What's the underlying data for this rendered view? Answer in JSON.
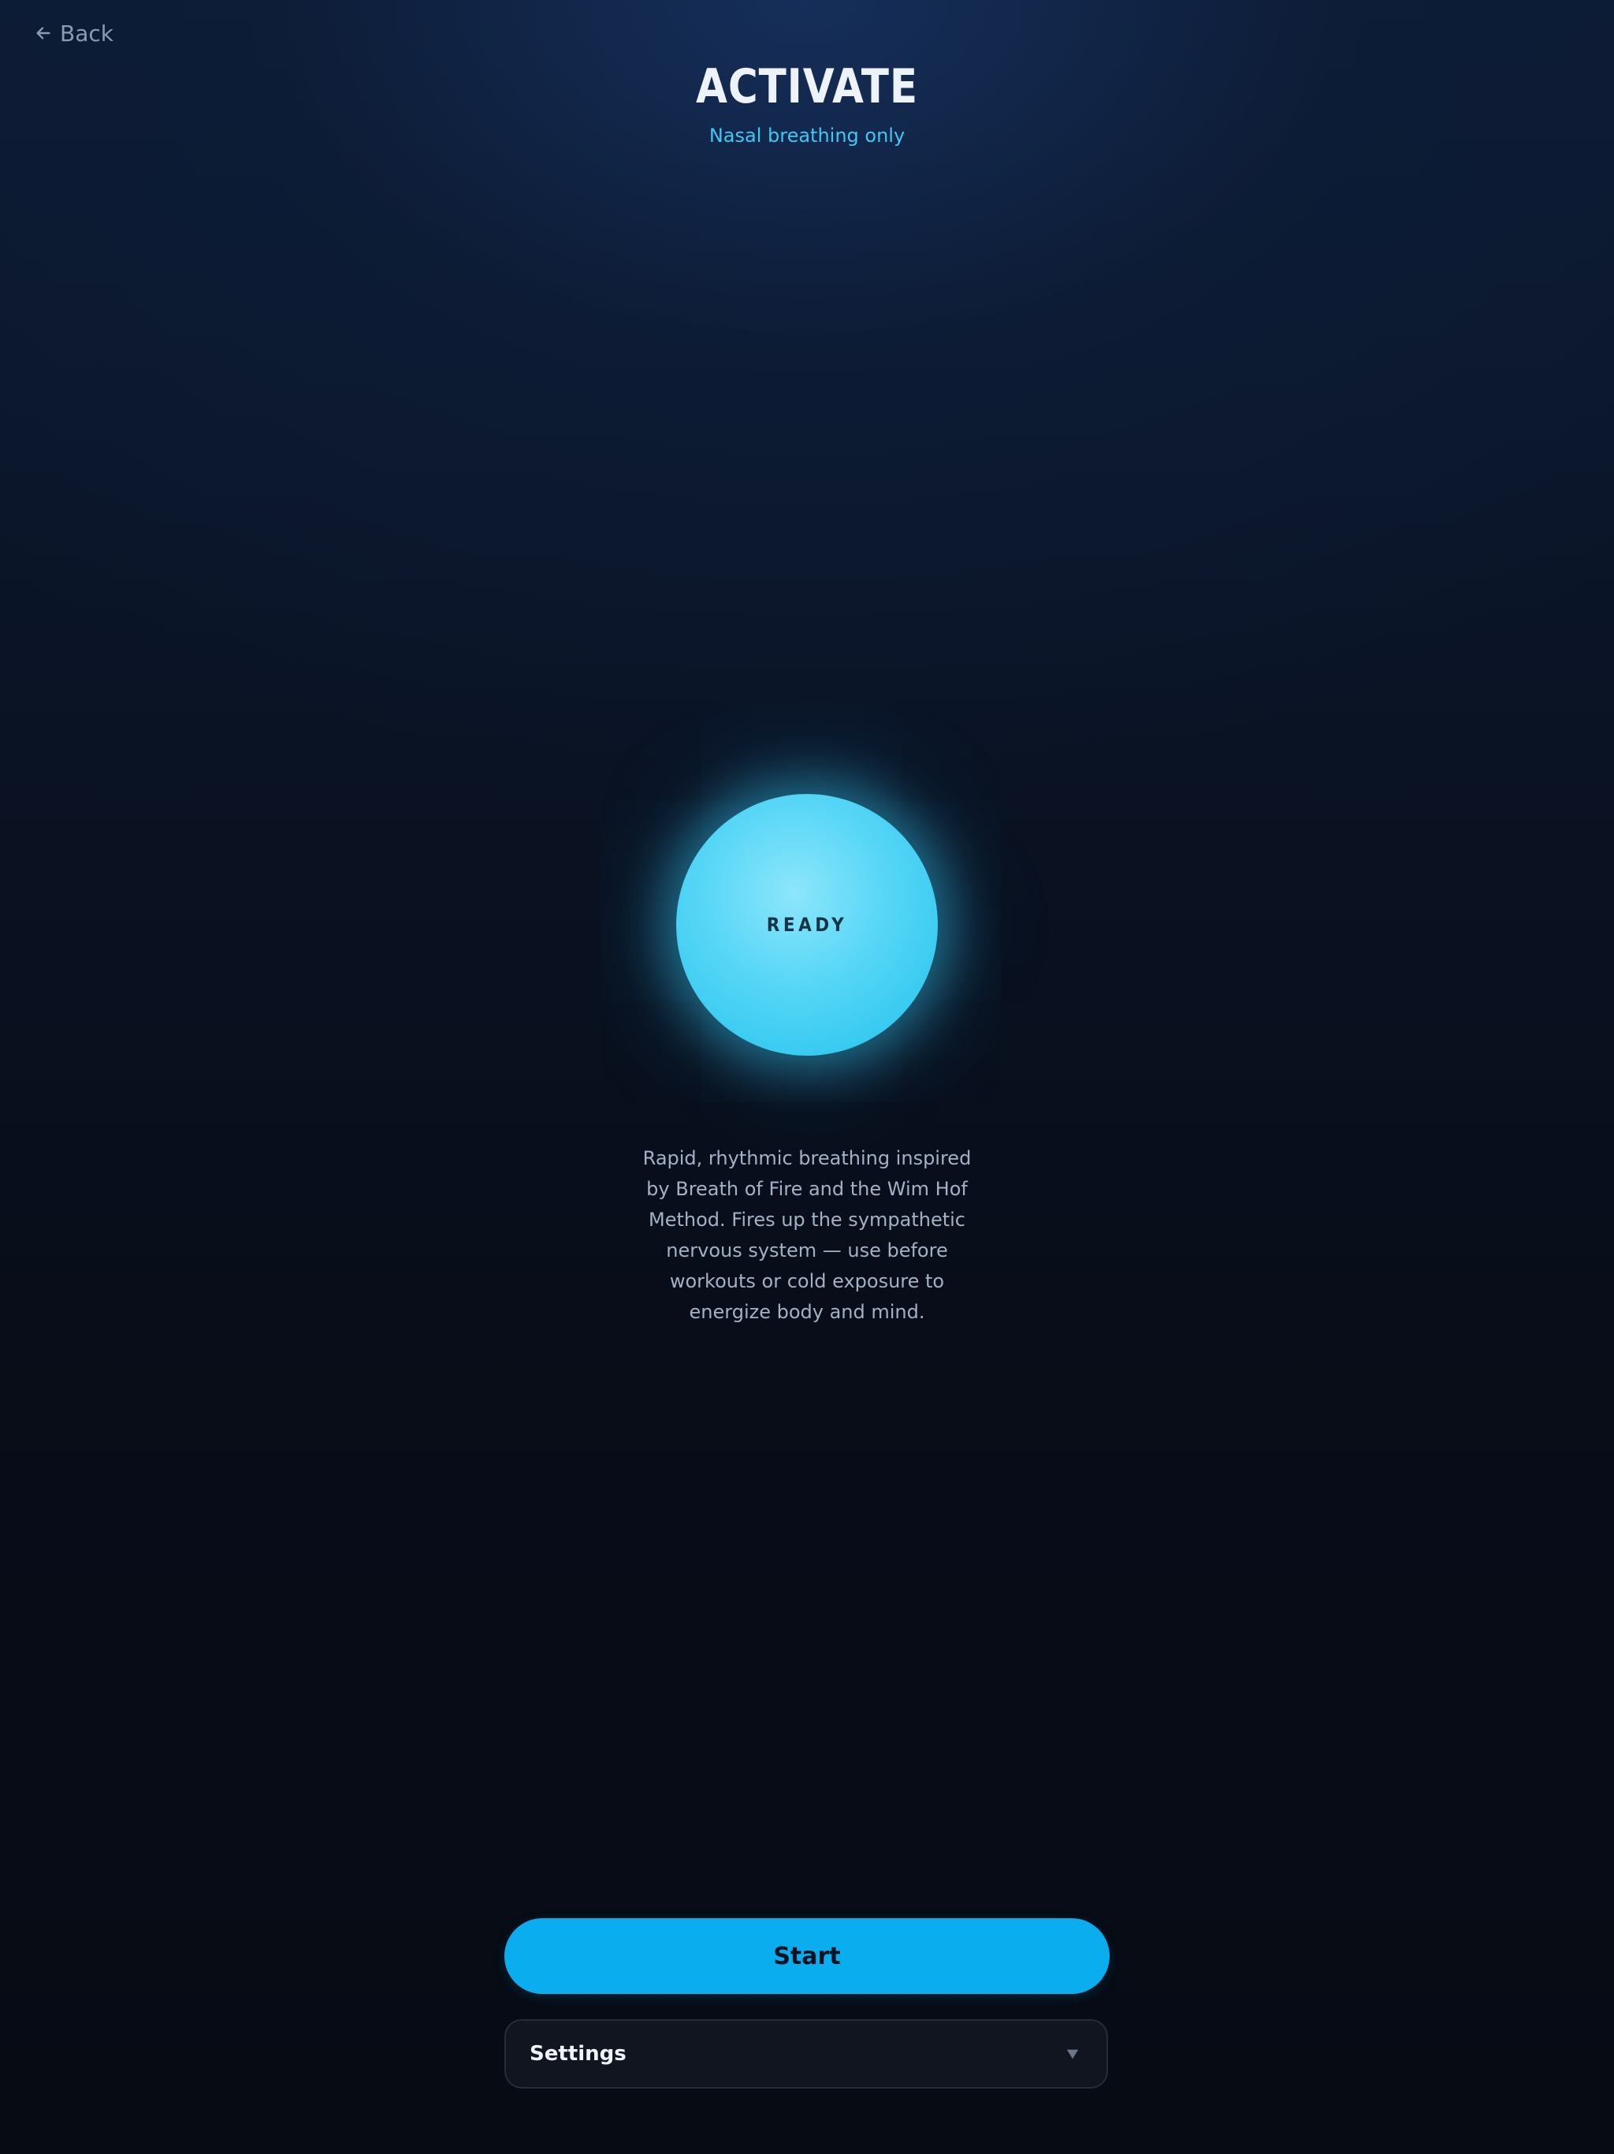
{
  "nav": {
    "back_label": "Back"
  },
  "header": {
    "title": "ACTIVATE",
    "subtitle": "Nasal breathing only"
  },
  "orb": {
    "state_label": "READY"
  },
  "description": "Rapid, rhythmic breathing inspired by Breath of Fire and the Wim Hof Method. Fires up the sympathetic nervous system — use before workouts or cold exposure to energize body and mind.",
  "actions": {
    "start_label": "Start",
    "settings_label": "Settings"
  },
  "icons": {
    "back": "arrow-left-icon",
    "settings": "chevron-down-icon"
  },
  "colors": {
    "accent": "#0aadee",
    "orb": "#38c8f1",
    "subtitle": "#3fc8f3",
    "background": "#070b14"
  }
}
